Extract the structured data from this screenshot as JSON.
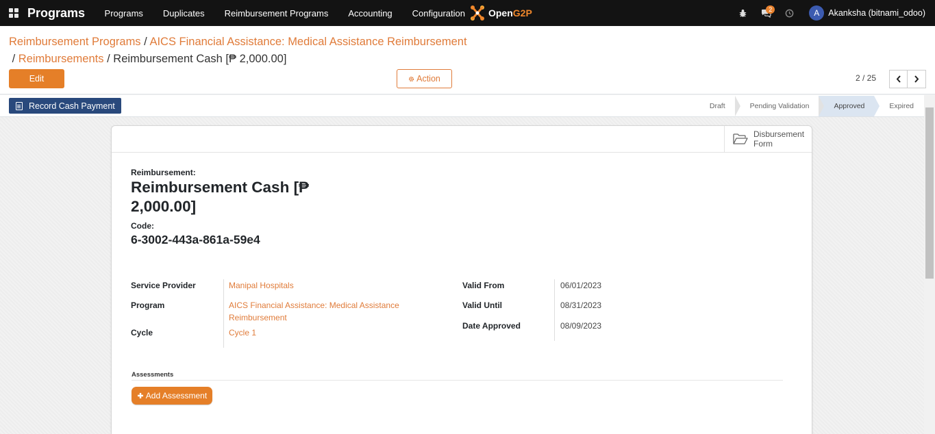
{
  "navbar": {
    "app_title": "Programs",
    "menu": [
      "Programs",
      "Duplicates",
      "Reimbursement Programs",
      "Accounting",
      "Configuration"
    ],
    "logo_part1": "Open",
    "logo_part2": "G2P",
    "messages_count": "2",
    "user_initial": "A",
    "user_name": "Akanksha (bitnami_odoo)"
  },
  "breadcrumb": {
    "item1": "Reimbursement Programs",
    "item2": "AICS Financial Assistance: Medical Assistance Reimbursement",
    "item3": "Reimbursements",
    "current": "Reimbursement Cash [₱ 2,000.00]",
    "separator": "/"
  },
  "buttons": {
    "edit": "Edit",
    "action": "Action",
    "record_cash_payment": "Record Cash Payment",
    "add_assessment": "Add Assessment"
  },
  "pager": {
    "text": "2 / 25"
  },
  "stages": [
    "Draft",
    "Pending Validation",
    "Approved",
    "Expired"
  ],
  "active_stage": "Approved",
  "smart_button": {
    "line1": "Disbursement",
    "line2": "Form"
  },
  "record": {
    "name_label": "Reimbursement:",
    "name_line1": "Reimbursement Cash [₱",
    "name_line2": "2,000.00]",
    "code_label": "Code:",
    "code": "6-3002-443a-861a-59e4"
  },
  "fields_left": {
    "service_provider_label": "Service Provider",
    "service_provider": "Manipal Hospitals",
    "program_label": "Program",
    "program_line1": "AICS Financial Assistance: Medical Assistance",
    "program_line2": "Reimbursement",
    "cycle_label": "Cycle",
    "cycle": "Cycle 1"
  },
  "fields_right": {
    "valid_from_label": "Valid From",
    "valid_from": "06/01/2023",
    "valid_until_label": "Valid Until",
    "valid_until": "08/31/2023",
    "date_approved_label": "Date Approved",
    "date_approved": "08/09/2023"
  },
  "assessments": {
    "title": "Assessments"
  },
  "colors": {
    "accent": "#e57f28",
    "link": "#e07b39",
    "navbar_bg": "#131313",
    "record_btn": "#29497c",
    "active_stage_bg": "#dbe5f1"
  }
}
